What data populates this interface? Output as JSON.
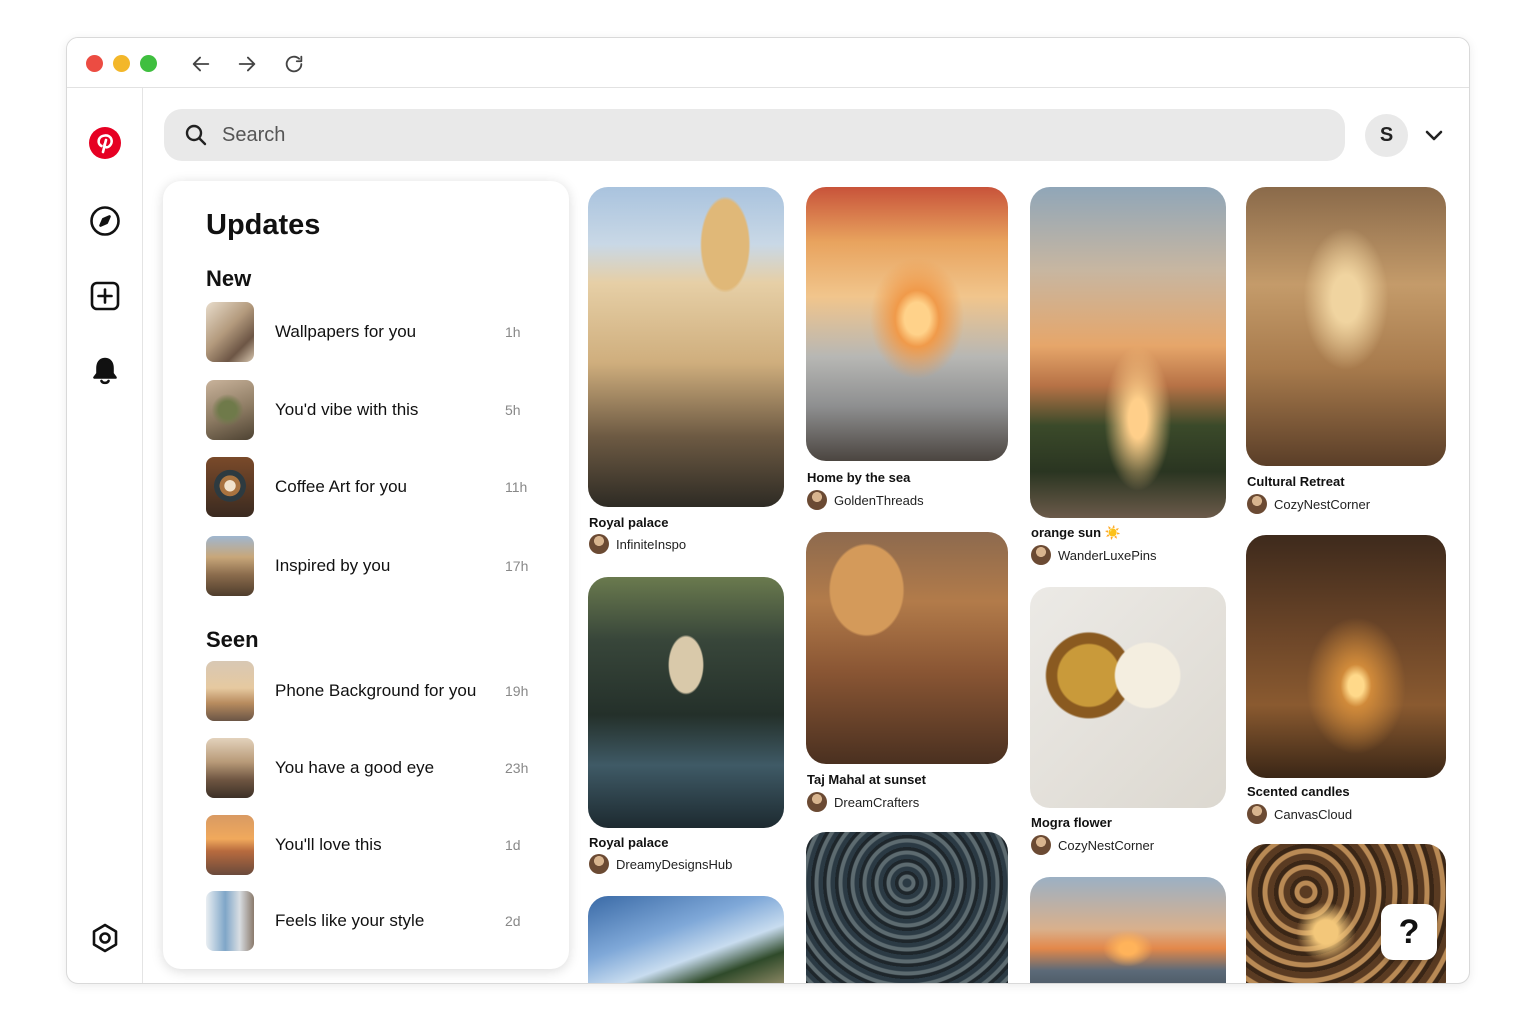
{
  "browser": {
    "back_icon": "arrow-left-icon",
    "forward_icon": "arrow-right-icon",
    "reload_icon": "reload-icon"
  },
  "sidebar": {
    "items": [
      {
        "icon": "pinterest-logo-icon"
      },
      {
        "icon": "compass-icon"
      },
      {
        "icon": "plus-square-icon"
      },
      {
        "icon": "bell-icon"
      },
      {
        "icon": "settings-icon"
      }
    ]
  },
  "search": {
    "placeholder": "Search"
  },
  "account": {
    "initial": "S"
  },
  "colors": {
    "brand": "#E60023",
    "search_bg": "#E9E9E9"
  },
  "updates": {
    "title": "Updates",
    "new_label": "New",
    "seen_label": "Seen",
    "new_items": [
      {
        "label": "Wallpapers for you",
        "time": "1h"
      },
      {
        "label": "You'd vibe with this",
        "time": "5h"
      },
      {
        "label": "Coffee Art for you",
        "time": "11h"
      },
      {
        "label": "Inspired by you",
        "time": "17h"
      }
    ],
    "seen_items": [
      {
        "label": "Phone Background for you",
        "time": "19h"
      },
      {
        "label": "You have a good eye",
        "time": "23h"
      },
      {
        "label": "You'll love this",
        "time": "1d"
      },
      {
        "label": "Feels like your style",
        "time": "2d"
      }
    ]
  },
  "pins": [
    {
      "title": "Royal palace",
      "user": "InfiniteInspo"
    },
    {
      "title": "Royal palace",
      "user": "DreamyDesignsHub"
    },
    {
      "title": "Home by the sea",
      "user": "GoldenThreads"
    },
    {
      "title": "Taj Mahal at sunset",
      "user": "DreamCrafters"
    },
    {
      "title": "orange sun ☀️",
      "user": "WanderLuxePins"
    },
    {
      "title": "Mogra flower",
      "user": "CozyNestCorner"
    },
    {
      "title": "Cultural Retreat",
      "user": "CozyNestCorner"
    },
    {
      "title": "Scented candles",
      "user": "CanvasCloud"
    }
  ],
  "help": {
    "label": "?"
  }
}
